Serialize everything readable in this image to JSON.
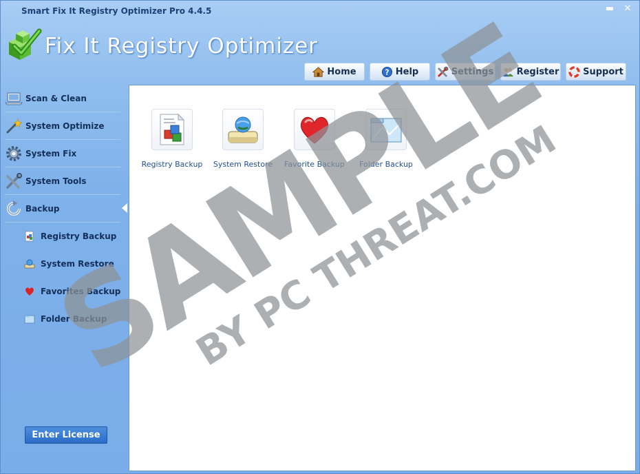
{
  "window": {
    "title": "Smart Fix It Registry Optimizer Pro 4.4.5",
    "minimize_glyph": "▬",
    "close_glyph": "✕"
  },
  "header": {
    "app_title": "Fix It Registry Optimizer",
    "buttons": [
      {
        "label": "Home",
        "icon": "home-icon"
      },
      {
        "label": "Help",
        "icon": "help-icon"
      },
      {
        "label": "Settings",
        "icon": "settings-icon"
      },
      {
        "label": "Register",
        "icon": "register-icon"
      },
      {
        "label": "Support",
        "icon": "support-icon"
      }
    ]
  },
  "sidebar": {
    "items": [
      {
        "label": "Scan & Clean",
        "icon": "laptop-icon"
      },
      {
        "label": "System Optimize",
        "icon": "magic-wand-icon"
      },
      {
        "label": "System Fix",
        "icon": "gear-icon"
      },
      {
        "label": "System Tools",
        "icon": "tools-icon"
      },
      {
        "label": "Backup",
        "icon": "backup-icon"
      }
    ],
    "sub_items": [
      {
        "label": "Registry Backup",
        "icon": "registry-icon"
      },
      {
        "label": "System Restore",
        "icon": "restore-icon"
      },
      {
        "label": "Favorites Backup",
        "icon": "heart-icon"
      },
      {
        "label": "Folder Backup",
        "icon": "folder-icon"
      }
    ],
    "license_button": "Enter License"
  },
  "content": {
    "tiles": [
      {
        "label": "Registry Backup",
        "icon": "registry-icon"
      },
      {
        "label": "System Restore",
        "icon": "restore-icon"
      },
      {
        "label": "Favorite Backup",
        "icon": "heart-icon"
      },
      {
        "label": "Folder Backup",
        "icon": "folder-icon"
      }
    ]
  },
  "watermark": {
    "main": "SAMPLE",
    "sub": "BY PC THREAT.COM"
  },
  "colors": {
    "accent": "#2a6cc7",
    "window_bg": "#7fb1ea",
    "label_text": "#142f59",
    "tile_label": "#1f4f96"
  }
}
